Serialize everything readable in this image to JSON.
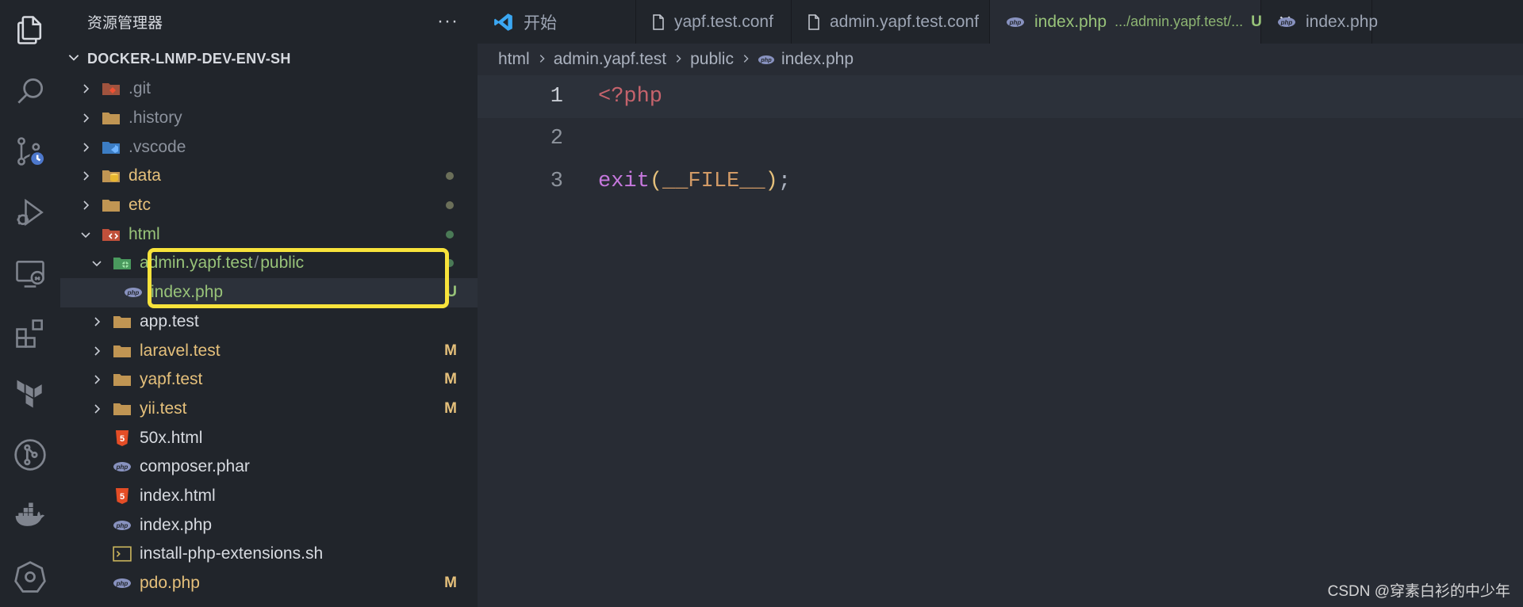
{
  "sidebar": {
    "title": "资源管理器",
    "more": "···",
    "project": "DOCKER-LNMP-DEV-ENV-SH",
    "items": [
      {
        "label": ".git",
        "level": 0,
        "chevron": "right",
        "icon": "git-folder-icon",
        "color": "dim",
        "status": ""
      },
      {
        "label": ".history",
        "level": 0,
        "chevron": "right",
        "icon": "folder-icon",
        "color": "dim",
        "status": ""
      },
      {
        "label": ".vscode",
        "level": 0,
        "chevron": "right",
        "icon": "vscode-folder-icon",
        "color": "dim",
        "status": ""
      },
      {
        "label": "data",
        "level": 0,
        "chevron": "right",
        "icon": "database-folder-icon",
        "color": "yellow",
        "status": "dot"
      },
      {
        "label": "etc",
        "level": 0,
        "chevron": "right",
        "icon": "folder-icon",
        "color": "yellow",
        "status": "dot"
      },
      {
        "label": "html",
        "level": 0,
        "chevron": "down",
        "icon": "html-folder-icon",
        "color": "green",
        "status": "dot-green"
      },
      {
        "label": "admin.yapf.test",
        "label2": "public",
        "sep": "/",
        "level": 1,
        "chevron": "down",
        "icon": "public-folder-icon",
        "color": "green",
        "status": "dot-green"
      },
      {
        "label": "index.php",
        "level": 2,
        "chevron": "",
        "icon": "php-icon",
        "color": "green",
        "status": "U",
        "selected": true
      },
      {
        "label": "app.test",
        "level": 1,
        "chevron": "right",
        "icon": "folder-icon",
        "color": "white",
        "status": ""
      },
      {
        "label": "laravel.test",
        "level": 1,
        "chevron": "right",
        "icon": "folder-icon",
        "color": "yellow",
        "status": "M"
      },
      {
        "label": "yapf.test",
        "level": 1,
        "chevron": "right",
        "icon": "folder-icon",
        "color": "yellow",
        "status": "M"
      },
      {
        "label": "yii.test",
        "level": 1,
        "chevron": "right",
        "icon": "folder-icon",
        "color": "yellow",
        "status": "M"
      },
      {
        "label": "50x.html",
        "level": 1,
        "chevron": "",
        "icon": "html5-icon",
        "color": "white",
        "status": ""
      },
      {
        "label": "composer.phar",
        "level": 1,
        "chevron": "",
        "icon": "php-icon",
        "color": "white",
        "status": ""
      },
      {
        "label": "index.html",
        "level": 1,
        "chevron": "",
        "icon": "html5-icon",
        "color": "white",
        "status": ""
      },
      {
        "label": "index.php",
        "level": 1,
        "chevron": "",
        "icon": "php-icon",
        "color": "white",
        "status": ""
      },
      {
        "label": "install-php-extensions.sh",
        "level": 1,
        "chevron": "",
        "icon": "terminal-icon",
        "color": "white",
        "status": ""
      },
      {
        "label": "pdo.php",
        "level": 1,
        "chevron": "",
        "icon": "php-icon",
        "color": "yellow",
        "status": "M"
      }
    ]
  },
  "tabs": [
    {
      "label": "开始",
      "icon": "vscode-logo-icon",
      "active": false
    },
    {
      "label": "yapf.test.conf",
      "icon": "file-icon",
      "active": false
    },
    {
      "label": "admin.yapf.test.conf",
      "icon": "file-icon",
      "active": false
    },
    {
      "label": "index.php",
      "path": ".../admin.yapf.test/...",
      "status": "U",
      "close": "✕",
      "icon": "php-icon",
      "active": true
    },
    {
      "label": "index.php",
      "icon": "php-icon",
      "active": false
    }
  ],
  "breadcrumb": [
    "html",
    "admin.yapf.test",
    "public",
    "index.php"
  ],
  "editor": {
    "lines": [
      {
        "num": "1",
        "tokens": [
          {
            "t": "<?php",
            "c": "tag"
          }
        ]
      },
      {
        "num": "2",
        "tokens": []
      },
      {
        "num": "3",
        "tokens": [
          {
            "t": "exit",
            "c": "fn"
          },
          {
            "t": "(",
            "c": "paren"
          },
          {
            "t": "__FILE__",
            "c": "const"
          },
          {
            "t": ")",
            "c": "paren"
          },
          {
            "t": ";",
            "c": "punc"
          }
        ]
      }
    ]
  },
  "watermark": "CSDN @穿素白衫的中少年",
  "colors": {
    "accent": "#98c379",
    "highlight": "#f8e33b",
    "modified": "#e5c07b"
  }
}
